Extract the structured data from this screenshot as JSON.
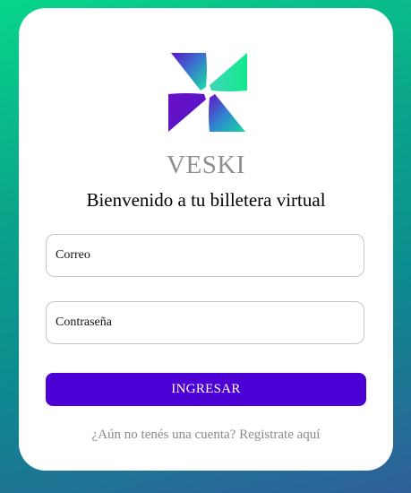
{
  "brand": {
    "name": "VESKI",
    "logo_icon": "veski-pinwheel-logo-icon"
  },
  "login": {
    "welcome": "Bienvenido a tu billetera virtual",
    "email_placeholder": "Correo",
    "email_value": "",
    "password_placeholder": "Contraseña",
    "password_value": "",
    "submit_label": "INGRESAR",
    "no_account_text": "¿Aún no tenés una cuenta?",
    "register_link": "Registrate aquí"
  },
  "colors": {
    "accent": "#4d00d6",
    "background_top": "#07d589",
    "background_bottom": "#2e5f9a",
    "brand_text": "#8e8e8e",
    "logo_purple": "#5a0fc8",
    "logo_teal": "#1fe0a0"
  }
}
